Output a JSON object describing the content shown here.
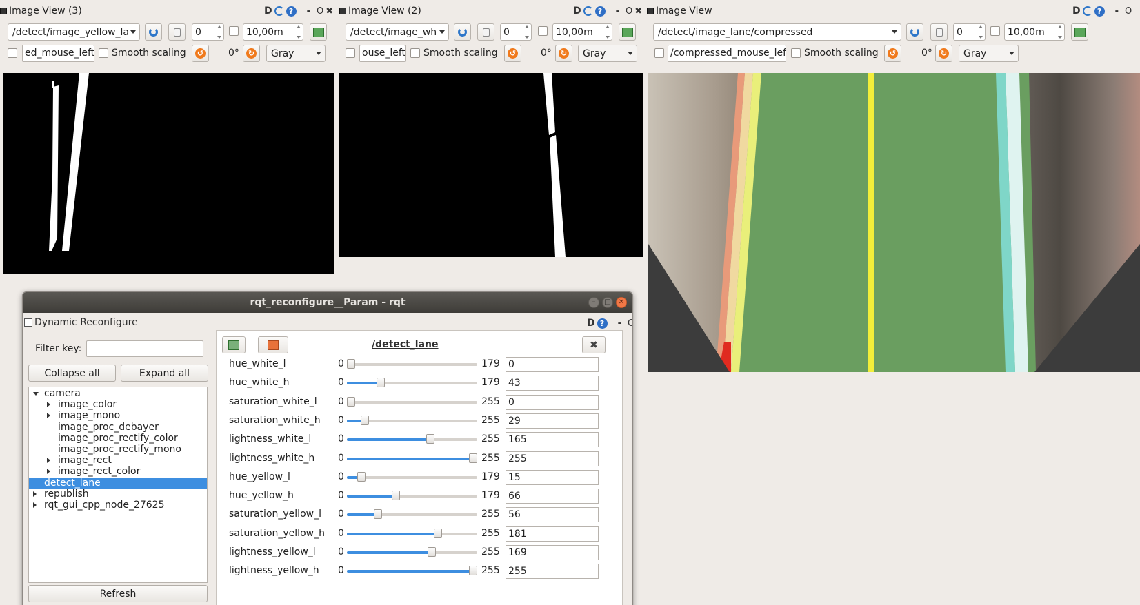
{
  "views": [
    {
      "title": "Image View (3)",
      "topic": "/detect/image_yellow_la",
      "spin_value": "0",
      "zoom_value": "10,00m",
      "mouse_topic": "ed_mouse_left",
      "smooth_label": "Smooth scaling",
      "rotation": "0°",
      "color_scheme": "Gray"
    },
    {
      "title": "Image View (2)",
      "topic": "/detect/image_wh",
      "spin_value": "0",
      "zoom_value": "10,00m",
      "mouse_topic": "ouse_left",
      "smooth_label": "Smooth scaling",
      "rotation": "0°",
      "color_scheme": "Gray"
    },
    {
      "title": "Image View",
      "topic": "/detect/image_lane/compressed",
      "spin_value": "0",
      "zoom_value": "10,00m",
      "mouse_topic": "/compressed_mouse_left",
      "smooth_label": "Smooth scaling",
      "rotation": "0°",
      "color_scheme": "Gray"
    }
  ],
  "title_controls": {
    "d": "D",
    "q": "?",
    "dash": "-",
    "o": "O",
    "x": "✖"
  },
  "window": {
    "title": "rqt_reconfigure__Param - rqt",
    "plugin_title": "Dynamic Reconfigure",
    "filter_label": "Filter key:",
    "filter_value": "",
    "collapse_label": "Collapse all",
    "expand_label": "Expand all",
    "refresh_label": "Refresh",
    "node_title": "/detect_lane",
    "tree": [
      {
        "label": "camera",
        "depth": 0,
        "arrow": "down",
        "selected": false
      },
      {
        "label": "image_color",
        "depth": 1,
        "arrow": "right",
        "selected": false
      },
      {
        "label": "image_mono",
        "depth": 1,
        "arrow": "right",
        "selected": false
      },
      {
        "label": "image_proc_debayer",
        "depth": 1,
        "arrow": "none",
        "selected": false
      },
      {
        "label": "image_proc_rectify_color",
        "depth": 1,
        "arrow": "none",
        "selected": false
      },
      {
        "label": "image_proc_rectify_mono",
        "depth": 1,
        "arrow": "none",
        "selected": false
      },
      {
        "label": "image_rect",
        "depth": 1,
        "arrow": "right",
        "selected": false
      },
      {
        "label": "image_rect_color",
        "depth": 1,
        "arrow": "right",
        "selected": false
      },
      {
        "label": "detect_lane",
        "depth": 0,
        "arrow": "none",
        "selected": true
      },
      {
        "label": "republish",
        "depth": 0,
        "arrow": "right",
        "selected": false
      },
      {
        "label": "rqt_gui_cpp_node_27625",
        "depth": 0,
        "arrow": "right",
        "selected": false
      }
    ],
    "params": [
      {
        "name": "hue_white_l",
        "min": "0",
        "max": "179",
        "value": "0"
      },
      {
        "name": "hue_white_h",
        "min": "0",
        "max": "179",
        "value": "43"
      },
      {
        "name": "saturation_white_l",
        "min": "0",
        "max": "255",
        "value": "0"
      },
      {
        "name": "saturation_white_h",
        "min": "0",
        "max": "255",
        "value": "29"
      },
      {
        "name": "lightness_white_l",
        "min": "0",
        "max": "255",
        "value": "165"
      },
      {
        "name": "lightness_white_h",
        "min": "0",
        "max": "255",
        "value": "255"
      },
      {
        "name": "hue_yellow_l",
        "min": "0",
        "max": "179",
        "value": "15"
      },
      {
        "name": "hue_yellow_h",
        "min": "0",
        "max": "179",
        "value": "66"
      },
      {
        "name": "saturation_yellow_l",
        "min": "0",
        "max": "255",
        "value": "56"
      },
      {
        "name": "saturation_yellow_h",
        "min": "0",
        "max": "255",
        "value": "181"
      },
      {
        "name": "lightness_yellow_l",
        "min": "0",
        "max": "255",
        "value": "169"
      },
      {
        "name": "lightness_yellow_h",
        "min": "0",
        "max": "255",
        "value": "255"
      }
    ]
  },
  "colors": {
    "selection": "#3d8ee0",
    "lane_green": "#6a9e60",
    "lane_yellow": "#f2ee3a"
  }
}
